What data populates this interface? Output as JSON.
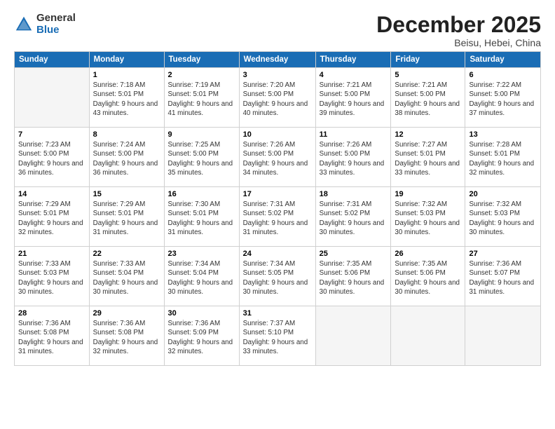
{
  "logo": {
    "general": "General",
    "blue": "Blue"
  },
  "title": "December 2025",
  "location": "Beisu, Hebei, China",
  "days_of_week": [
    "Sunday",
    "Monday",
    "Tuesday",
    "Wednesday",
    "Thursday",
    "Friday",
    "Saturday"
  ],
  "weeks": [
    [
      {
        "num": "",
        "empty": true
      },
      {
        "num": "1",
        "sunrise": "Sunrise: 7:18 AM",
        "sunset": "Sunset: 5:01 PM",
        "daylight": "Daylight: 9 hours and 43 minutes."
      },
      {
        "num": "2",
        "sunrise": "Sunrise: 7:19 AM",
        "sunset": "Sunset: 5:01 PM",
        "daylight": "Daylight: 9 hours and 41 minutes."
      },
      {
        "num": "3",
        "sunrise": "Sunrise: 7:20 AM",
        "sunset": "Sunset: 5:00 PM",
        "daylight": "Daylight: 9 hours and 40 minutes."
      },
      {
        "num": "4",
        "sunrise": "Sunrise: 7:21 AM",
        "sunset": "Sunset: 5:00 PM",
        "daylight": "Daylight: 9 hours and 39 minutes."
      },
      {
        "num": "5",
        "sunrise": "Sunrise: 7:21 AM",
        "sunset": "Sunset: 5:00 PM",
        "daylight": "Daylight: 9 hours and 38 minutes."
      },
      {
        "num": "6",
        "sunrise": "Sunrise: 7:22 AM",
        "sunset": "Sunset: 5:00 PM",
        "daylight": "Daylight: 9 hours and 37 minutes."
      }
    ],
    [
      {
        "num": "7",
        "sunrise": "Sunrise: 7:23 AM",
        "sunset": "Sunset: 5:00 PM",
        "daylight": "Daylight: 9 hours and 36 minutes."
      },
      {
        "num": "8",
        "sunrise": "Sunrise: 7:24 AM",
        "sunset": "Sunset: 5:00 PM",
        "daylight": "Daylight: 9 hours and 36 minutes."
      },
      {
        "num": "9",
        "sunrise": "Sunrise: 7:25 AM",
        "sunset": "Sunset: 5:00 PM",
        "daylight": "Daylight: 9 hours and 35 minutes."
      },
      {
        "num": "10",
        "sunrise": "Sunrise: 7:26 AM",
        "sunset": "Sunset: 5:00 PM",
        "daylight": "Daylight: 9 hours and 34 minutes."
      },
      {
        "num": "11",
        "sunrise": "Sunrise: 7:26 AM",
        "sunset": "Sunset: 5:00 PM",
        "daylight": "Daylight: 9 hours and 33 minutes."
      },
      {
        "num": "12",
        "sunrise": "Sunrise: 7:27 AM",
        "sunset": "Sunset: 5:01 PM",
        "daylight": "Daylight: 9 hours and 33 minutes."
      },
      {
        "num": "13",
        "sunrise": "Sunrise: 7:28 AM",
        "sunset": "Sunset: 5:01 PM",
        "daylight": "Daylight: 9 hours and 32 minutes."
      }
    ],
    [
      {
        "num": "14",
        "sunrise": "Sunrise: 7:29 AM",
        "sunset": "Sunset: 5:01 PM",
        "daylight": "Daylight: 9 hours and 32 minutes."
      },
      {
        "num": "15",
        "sunrise": "Sunrise: 7:29 AM",
        "sunset": "Sunset: 5:01 PM",
        "daylight": "Daylight: 9 hours and 31 minutes."
      },
      {
        "num": "16",
        "sunrise": "Sunrise: 7:30 AM",
        "sunset": "Sunset: 5:01 PM",
        "daylight": "Daylight: 9 hours and 31 minutes."
      },
      {
        "num": "17",
        "sunrise": "Sunrise: 7:31 AM",
        "sunset": "Sunset: 5:02 PM",
        "daylight": "Daylight: 9 hours and 31 minutes."
      },
      {
        "num": "18",
        "sunrise": "Sunrise: 7:31 AM",
        "sunset": "Sunset: 5:02 PM",
        "daylight": "Daylight: 9 hours and 30 minutes."
      },
      {
        "num": "19",
        "sunrise": "Sunrise: 7:32 AM",
        "sunset": "Sunset: 5:03 PM",
        "daylight": "Daylight: 9 hours and 30 minutes."
      },
      {
        "num": "20",
        "sunrise": "Sunrise: 7:32 AM",
        "sunset": "Sunset: 5:03 PM",
        "daylight": "Daylight: 9 hours and 30 minutes."
      }
    ],
    [
      {
        "num": "21",
        "sunrise": "Sunrise: 7:33 AM",
        "sunset": "Sunset: 5:03 PM",
        "daylight": "Daylight: 9 hours and 30 minutes."
      },
      {
        "num": "22",
        "sunrise": "Sunrise: 7:33 AM",
        "sunset": "Sunset: 5:04 PM",
        "daylight": "Daylight: 9 hours and 30 minutes."
      },
      {
        "num": "23",
        "sunrise": "Sunrise: 7:34 AM",
        "sunset": "Sunset: 5:04 PM",
        "daylight": "Daylight: 9 hours and 30 minutes."
      },
      {
        "num": "24",
        "sunrise": "Sunrise: 7:34 AM",
        "sunset": "Sunset: 5:05 PM",
        "daylight": "Daylight: 9 hours and 30 minutes."
      },
      {
        "num": "25",
        "sunrise": "Sunrise: 7:35 AM",
        "sunset": "Sunset: 5:06 PM",
        "daylight": "Daylight: 9 hours and 30 minutes."
      },
      {
        "num": "26",
        "sunrise": "Sunrise: 7:35 AM",
        "sunset": "Sunset: 5:06 PM",
        "daylight": "Daylight: 9 hours and 30 minutes."
      },
      {
        "num": "27",
        "sunrise": "Sunrise: 7:36 AM",
        "sunset": "Sunset: 5:07 PM",
        "daylight": "Daylight: 9 hours and 31 minutes."
      }
    ],
    [
      {
        "num": "28",
        "sunrise": "Sunrise: 7:36 AM",
        "sunset": "Sunset: 5:08 PM",
        "daylight": "Daylight: 9 hours and 31 minutes."
      },
      {
        "num": "29",
        "sunrise": "Sunrise: 7:36 AM",
        "sunset": "Sunset: 5:08 PM",
        "daylight": "Daylight: 9 hours and 32 minutes."
      },
      {
        "num": "30",
        "sunrise": "Sunrise: 7:36 AM",
        "sunset": "Sunset: 5:09 PM",
        "daylight": "Daylight: 9 hours and 32 minutes."
      },
      {
        "num": "31",
        "sunrise": "Sunrise: 7:37 AM",
        "sunset": "Sunset: 5:10 PM",
        "daylight": "Daylight: 9 hours and 33 minutes."
      },
      {
        "num": "",
        "empty": true
      },
      {
        "num": "",
        "empty": true
      },
      {
        "num": "",
        "empty": true
      }
    ]
  ]
}
